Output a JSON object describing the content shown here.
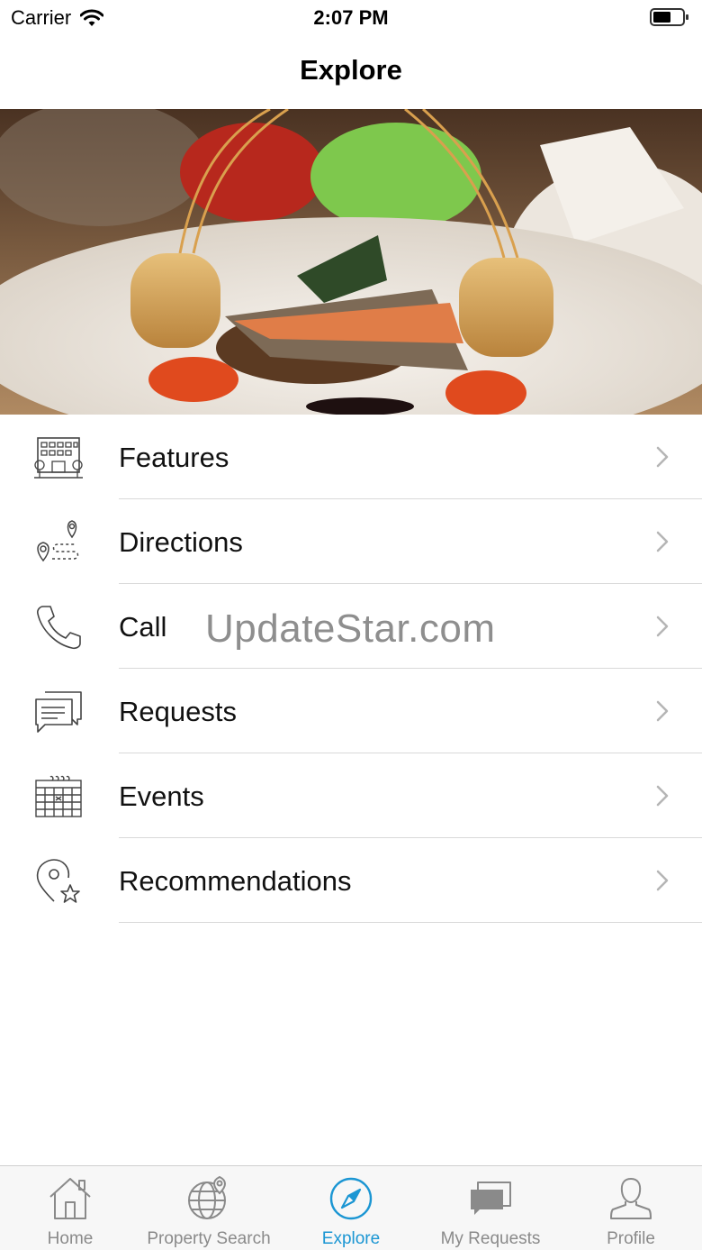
{
  "status_bar": {
    "carrier": "Carrier",
    "time": "2:07 PM"
  },
  "nav": {
    "title": "Explore"
  },
  "menu": {
    "items": [
      {
        "label": "Features",
        "icon": "building-icon"
      },
      {
        "label": "Directions",
        "icon": "directions-icon"
      },
      {
        "label": "Call",
        "icon": "phone-icon"
      },
      {
        "label": "Requests",
        "icon": "chat-icon"
      },
      {
        "label": "Events",
        "icon": "calendar-icon"
      },
      {
        "label": "Recommendations",
        "icon": "location-star-icon"
      }
    ]
  },
  "watermark": "UpdateStar.com",
  "tab_bar": {
    "tabs": [
      {
        "label": "Home",
        "icon": "home-icon",
        "active": false
      },
      {
        "label": "Property Search",
        "icon": "globe-pin-icon",
        "active": false
      },
      {
        "label": "Explore",
        "icon": "compass-icon",
        "active": true
      },
      {
        "label": "My Requests",
        "icon": "chat-bubbles-icon",
        "active": false
      },
      {
        "label": "Profile",
        "icon": "person-icon",
        "active": false
      }
    ]
  },
  "colors": {
    "accent": "#1b96d3",
    "inactive": "#8a8a8a",
    "divider": "#d9d9d9"
  }
}
